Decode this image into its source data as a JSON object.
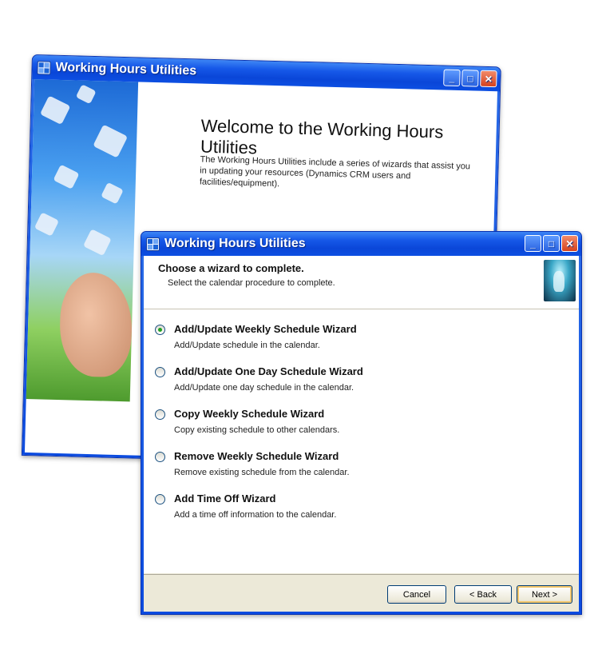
{
  "back_window": {
    "title": "Working Hours Utilities",
    "heading": "Welcome to the Working Hours Utilities",
    "text": "The Working Hours Utilities include a series of wizards that assist you in updating your resources (Dynamics CRM users and facilities/equipment)."
  },
  "front_window": {
    "title": "Working Hours Utilities",
    "header_title": "Choose a wizard to complete.",
    "header_subtitle": "Select the calendar procedure to complete.",
    "options": [
      {
        "label": "Add/Update Weekly Schedule Wizard",
        "desc": "Add/Update schedule in the calendar.",
        "selected": true
      },
      {
        "label": "Add/Update One Day Schedule Wizard",
        "desc": "Add/Update one day schedule in the calendar.",
        "selected": false
      },
      {
        "label": "Copy Weekly Schedule Wizard",
        "desc": "Copy existing schedule to other calendars.",
        "selected": false
      },
      {
        "label": "Remove Weekly Schedule Wizard",
        "desc": "Remove existing schedule from the calendar.",
        "selected": false
      },
      {
        "label": "Add Time Off Wizard",
        "desc": "Add a time off information to the calendar.",
        "selected": false
      }
    ],
    "buttons": {
      "cancel": "Cancel",
      "back": "< Back",
      "next": "Next >"
    }
  },
  "icons": {
    "app": "app-grid-icon",
    "minimize": "minimize-icon",
    "maximize": "maximize-icon",
    "close": "close-icon"
  },
  "colors": {
    "titlebar": "#0a46d8",
    "window_face": "#ece9d8",
    "radio_selected": "#21a121"
  }
}
